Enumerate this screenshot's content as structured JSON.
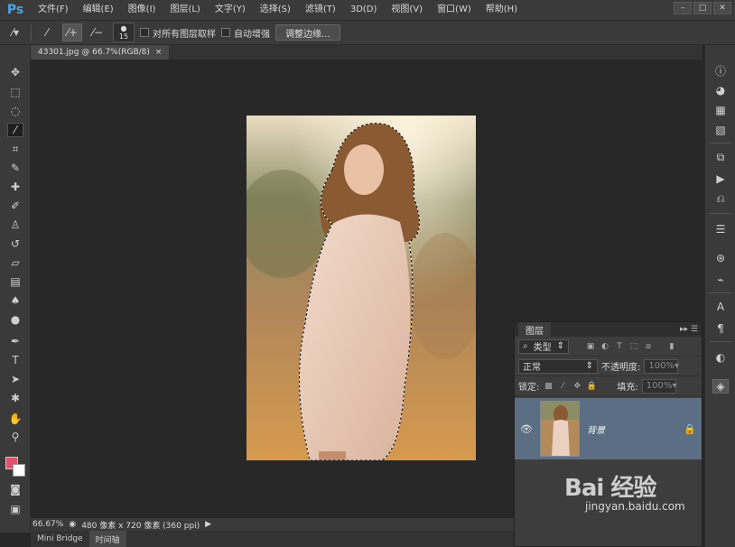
{
  "app": {
    "logo": "Ps"
  },
  "menu": [
    "文件(F)",
    "编辑(E)",
    "图像(I)",
    "图层(L)",
    "文字(Y)",
    "选择(S)",
    "滤镜(T)",
    "3D(D)",
    "视图(V)",
    "窗口(W)",
    "帮助(H)"
  ],
  "options": {
    "brush_size": "15",
    "sample_all_layers": "对所有图层取样",
    "auto_enhance": "自动增强",
    "refine_edge": "调整边缘..."
  },
  "document": {
    "tab_title": "43301.jpg @ 66.7%(RGB/8)",
    "tab_close": "×"
  },
  "status": {
    "zoom": "66.67%",
    "doc_info": "480 像素 x 720 像素 (360 ppi)"
  },
  "bottom_tabs": [
    "Mini Bridge",
    "时间轴"
  ],
  "layers_panel": {
    "title": "图层",
    "filter_kind": "类型",
    "blend_mode": "正常",
    "opacity_label": "不透明度:",
    "opacity_value": "100%",
    "lock_label": "锁定:",
    "fill_label": "填充:",
    "fill_value": "100%",
    "layers": [
      {
        "name": "背景"
      }
    ]
  },
  "watermark": {
    "logo": "Bai 经验",
    "url": "jingyan.baidu.com"
  }
}
